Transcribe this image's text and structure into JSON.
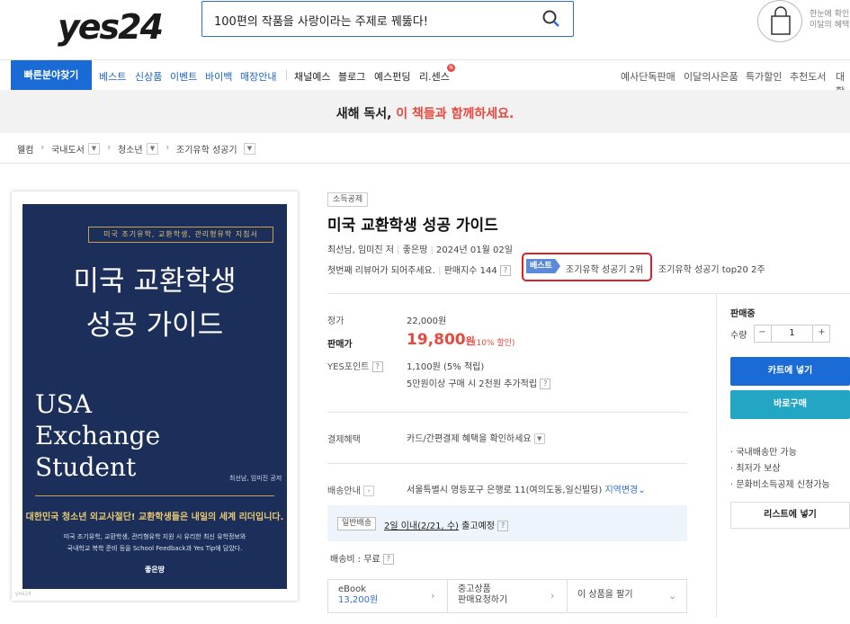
{
  "header": {
    "logo": "yes24",
    "search_value": "100편의 작품을 사랑이라는 주제로 꿰뚫다!",
    "cart_text_line1": "한눈에 확인",
    "cart_text_line2": "이달의 혜택"
  },
  "nav": {
    "quick": "빠른분야찾기",
    "blue_items": [
      "베스트",
      "신상품",
      "이벤트",
      "바이백",
      "매장안내"
    ],
    "dark_items": [
      "채널예스",
      "블로그",
      "예스펀딩",
      "리.센스"
    ],
    "badge": "N",
    "right_items": [
      "예사단독판매",
      "이달의사은품",
      "특가할인",
      "추천도서",
      "대학"
    ]
  },
  "banner": {
    "text_plain": "새해 독서, ",
    "text_highlight": "이 책들과 함께하세요."
  },
  "breadcrumb": [
    "웰컴",
    "국내도서",
    "청소년",
    "조기유학 성공기"
  ],
  "cover": {
    "tag": "미국 조기유학, 교환학생, 관리형유학 지침서",
    "title_line1": "미국 교환학생",
    "title_line2": "성공 가이드",
    "en_line1": "USA",
    "en_line2": "Exchange",
    "en_line3": "Student",
    "authors": "최선남, 임미진 공저",
    "slogan": "대한민국 청소년 외교사절단! 교환학생들은 내일의 세계 리더입니다.",
    "desc_line1": "미국 조기유학, 교환학생, 관리형유학 지원 시 유리한 최신 유학정보와",
    "desc_line2": "국내학교 복학 준비 등을 School Feedback과 Yes Tip에 담았다.",
    "publisher": "좋은땅",
    "watermark": "yes24"
  },
  "product": {
    "tax_badge": "소득공제",
    "title": "미국 교환학생 성공 가이드",
    "authors": "최선남, 임미진 저",
    "publisher": "좋은땅",
    "date": "2024년 01월 02일",
    "review_prompt": "첫번째 리뷰어가 되어주세요.",
    "sales_index": "판매지수 144",
    "best_tag": "베스트",
    "best_rank": "조기유학 성공기 2위",
    "top20": "조기유학 성공기 top20 2주"
  },
  "pricing": {
    "list_label": "정가",
    "list_price": "22,000원",
    "sale_label": "판매가",
    "sale_price": "19,800",
    "sale_unit": "원",
    "sale_rate": "(10% 할인)",
    "points_label": "YES포인트",
    "points_value": "1,100원 (5% 적립)",
    "points_extra": "5만원이상 구매 시 2천원 추가적립",
    "payment_label": "결제혜택",
    "payment_value": "카드/간편결제 혜택을 확인하세요",
    "delivery_label": "배송안내",
    "delivery_address": "서울특별시 영등포구 은행로 11(여의도동,일신빌딩)",
    "region_change": "지역변경",
    "ship_tag": "일반배송",
    "ship_date": "2일 이내(2/21, 수)",
    "ship_suffix": " 출고예정",
    "ship_fee": "배송비 : 무료"
  },
  "bottom": {
    "ebook_label": "eBook",
    "ebook_price": "13,200원",
    "used_line1": "중고상품",
    "used_line2": "판매요청하기",
    "sell_label": "이 상품을 팔기"
  },
  "panel": {
    "status": "판매중",
    "qty_label": "수량",
    "qty_value": "1",
    "cart_button": "카트에 넣기",
    "buy_button": "바로구매",
    "bullets": [
      "· 국내배송만 가능",
      "· 최저가 보상",
      "· 문화비소득공제 신청가능"
    ],
    "wishlist_button": "리스트에 넣기"
  },
  "colors": {
    "brand_blue": "#1a6bd6",
    "accent_red": "#e8493f",
    "teal": "#23a5c4",
    "cover_navy": "#1b2f5a",
    "highlight_box": "#d8232a"
  }
}
